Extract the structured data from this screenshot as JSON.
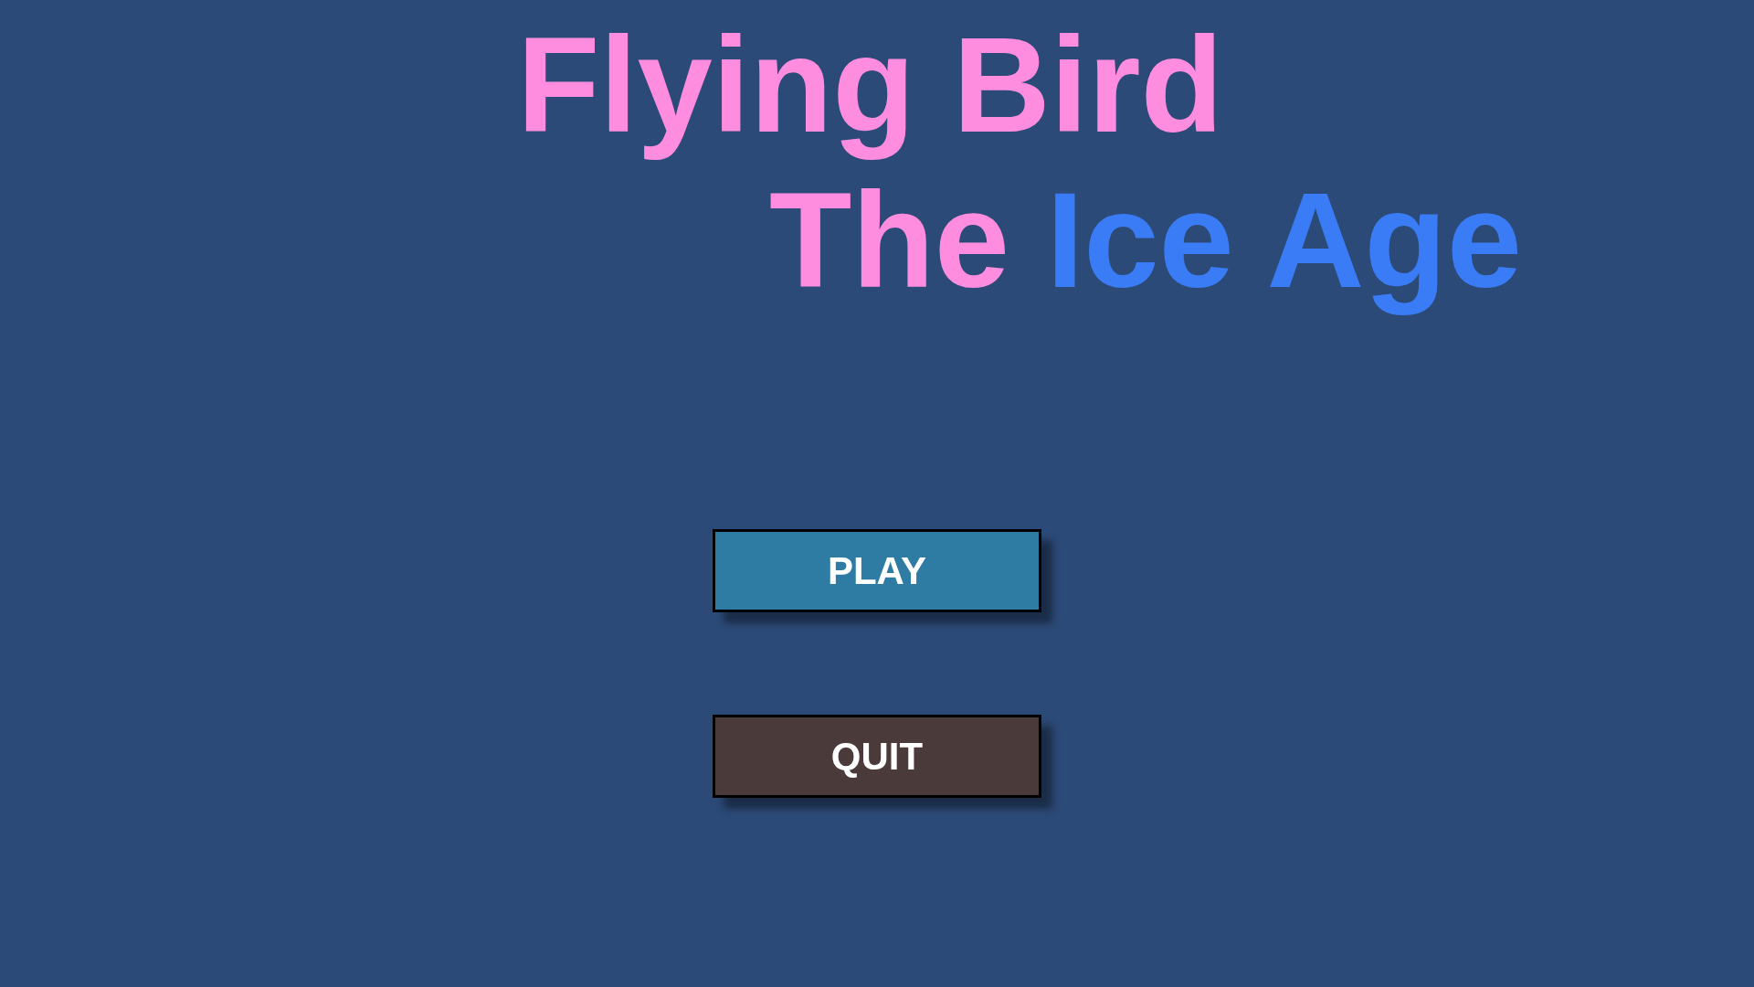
{
  "title": {
    "lines": [
      {
        "segments": [
          {
            "text": "Flying Bird",
            "color": "#ff8ddf"
          }
        ]
      },
      {
        "segments": [
          {
            "text": "The",
            "color": "#ff8ddf"
          },
          {
            "text": "Ice Age",
            "color": "#3a7cf5"
          }
        ]
      }
    ]
  },
  "buttons": [
    {
      "label": "PLAY",
      "color": "#2e7ba3"
    },
    {
      "label": "QUIT",
      "color": "#4b3a3a"
    }
  ]
}
